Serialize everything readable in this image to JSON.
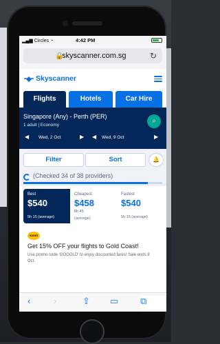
{
  "status": {
    "carrier": "Circles",
    "time": "4:42 PM"
  },
  "browser": {
    "url": "skyscanner.com.sg"
  },
  "brand": {
    "name": "Skyscanner",
    "accent": "#0770e3",
    "navy": "#042759"
  },
  "tabs": [
    {
      "label": "Flights"
    },
    {
      "label": "Hotels"
    },
    {
      "label": "Car Hire"
    }
  ],
  "search": {
    "route": "Singapore (Any) - Perth (PER)",
    "passengers": "1 adult",
    "cabin": "Economy",
    "depart": "Wed, 2 Oct",
    "return": "Wed, 9 Oct"
  },
  "filters": {
    "filter_label": "Filter",
    "sort_label": "Sort"
  },
  "progress": {
    "text": "(Checked 34 of 38 providers)",
    "checked": 34,
    "total": 38
  },
  "results": {
    "best": {
      "label": "Best",
      "price": "$540",
      "duration": "5h 15 (average)"
    },
    "cheapest": {
      "label": "Cheapest",
      "price": "$458",
      "sub": "8h 45",
      "duration": "(average)"
    },
    "fastest": {
      "label": "Fastest",
      "price": "$540",
      "duration": "5h 15 (average)"
    }
  },
  "promo": {
    "logo": "scoot",
    "title": "Get 15% OFF your flights to Gold Coast!",
    "body": "Use promo code 'GOGOLD' to enjoy discounted fares! Sale ends 8 Oct."
  },
  "icons": [
    "signal-icon",
    "wifi-icon",
    "battery-icon",
    "lock-icon",
    "reload-icon",
    "menu-icon",
    "search-icon",
    "bell-icon",
    "back-icon",
    "forward-icon",
    "share-icon",
    "bookmarks-icon",
    "tabs-icon"
  ]
}
